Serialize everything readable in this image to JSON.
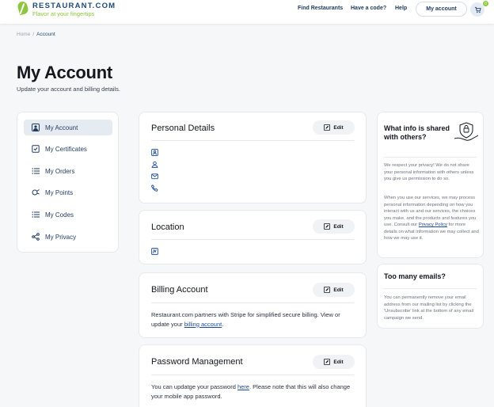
{
  "header": {
    "logo_name": "RESTAURANT.COM",
    "logo_tagline": "Flavor at your fingertips",
    "nav": [
      "Find Restaurants",
      "Have a code?",
      "Help"
    ],
    "account_button": "My account",
    "cart_count": "0"
  },
  "breadcrumb": {
    "home": "Home",
    "separator": "/",
    "current": "Account"
  },
  "page": {
    "title": "My Account",
    "subtitle": "Update your account and billing details."
  },
  "sidebar": {
    "items": [
      {
        "label": "My Account",
        "icon": "user-icon",
        "active": true
      },
      {
        "label": "My Certificates",
        "icon": "certificate-icon",
        "active": false
      },
      {
        "label": "My Orders",
        "icon": "list-icon",
        "active": false
      },
      {
        "label": "My Points",
        "icon": "points-icon",
        "active": false
      },
      {
        "label": "My Codes",
        "icon": "list-icon",
        "active": false
      },
      {
        "label": "My Privacy",
        "icon": "share-icon",
        "active": false
      }
    ]
  },
  "sections": {
    "edit_label": "Edit",
    "personal": {
      "title": "Personal Details",
      "icons": [
        "id-card-icon",
        "user-circle-icon",
        "mail-icon",
        "phone-icon"
      ]
    },
    "location": {
      "title": "Location",
      "icons": [
        "map-icon"
      ]
    },
    "billing": {
      "title": "Billing Account",
      "text_before": "Restaurant.com partners with Stripe for simplified secure billing. View or update your ",
      "link": "billing account",
      "text_after": "."
    },
    "password": {
      "title": "Password Management",
      "text_before": "You can updatge your password ",
      "link": "here",
      "text_after": ". Please note that this will also change your mobile app password."
    }
  },
  "info": {
    "shared": {
      "title": "What info is shared with others?",
      "p1": "We respect your privacy! We do not share your personal information with others unless you give us permission to do so.",
      "p2_before": "When you use our services, we may process personal information depending on how you interact with us and our services, the choices you make, and the products and features you use. Consult our ",
      "p2_link": "Privacy Policy",
      "p2_after": " for more details on what information we may collect and how we may use it."
    },
    "emails": {
      "title": "Too many emails?",
      "text": "You can permanently remove your email address from our mailing list by clicking the 'Unsubscribe' link at the bottom of any email campaign we send."
    }
  },
  "colors": {
    "brand_green": "#8dc63f",
    "brand_navy": "#1e4b7a"
  }
}
